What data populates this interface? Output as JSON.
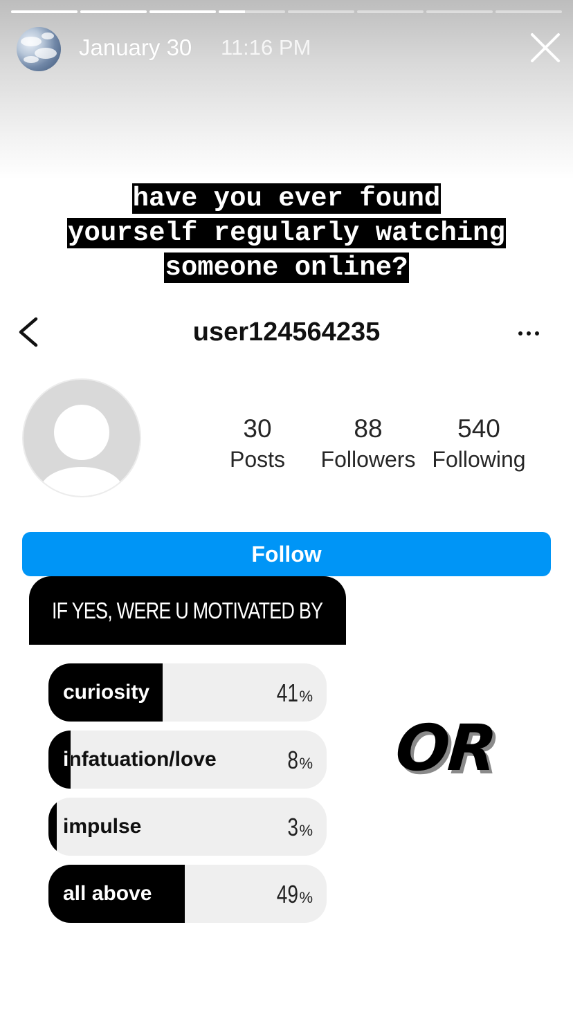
{
  "story": {
    "date": "January 30",
    "time": "11:16 PM",
    "progress_segments": [
      1,
      1,
      1,
      0.4,
      0,
      0,
      0,
      0
    ],
    "caption_lines": [
      "have you ever found",
      "yourself regularly watching",
      "someone online?"
    ]
  },
  "profile": {
    "username": "user124564235",
    "stats": [
      {
        "value": "30",
        "label": "Posts"
      },
      {
        "value": "88",
        "label": "Followers"
      },
      {
        "value": "540",
        "label": "Following"
      }
    ],
    "follow_label": "Follow"
  },
  "poll": {
    "question": "IF YES, WERE U MOTIVATED BY",
    "options": [
      {
        "label": "curiosity",
        "percent": "41",
        "fraction": 0.41
      },
      {
        "label": "infatuation/love",
        "percent": "8",
        "fraction": 0.08
      },
      {
        "label": "impulse",
        "percent": "3",
        "fraction": 0.03
      },
      {
        "label": "all above",
        "percent": "49",
        "fraction": 0.49
      }
    ],
    "percent_sign": "%"
  },
  "sticker": {
    "text": "OR"
  },
  "colors": {
    "follow_button": "#0095f6",
    "poll_bar": "#000000"
  },
  "icons": [
    "close-icon",
    "back-icon",
    "more-icon",
    "avatar-placeholder-icon"
  ]
}
